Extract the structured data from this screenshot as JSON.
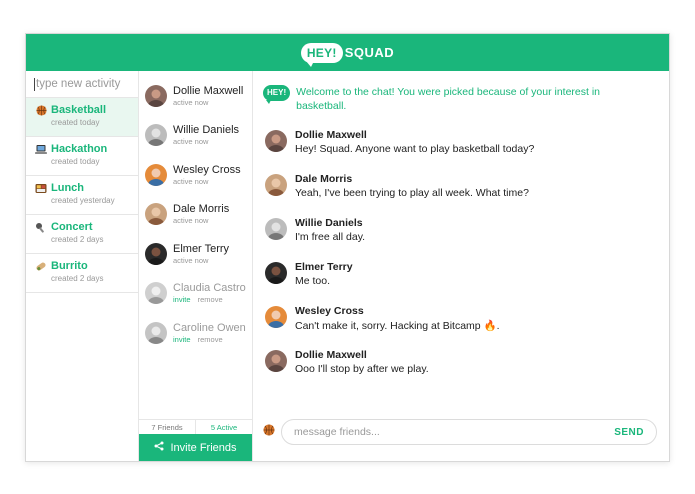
{
  "app": {
    "logo_bubble": "HEY!",
    "logo_text": "SQUAD",
    "brand_color": "#1ab67b"
  },
  "activities": {
    "placeholder": "type new activity",
    "items": [
      {
        "label": "Basketball",
        "sub": "created today",
        "icon": "basketball-icon",
        "active": true
      },
      {
        "label": "Hackathon",
        "sub": "created today",
        "icon": "laptop-icon"
      },
      {
        "label": "Lunch",
        "sub": "created yesterday",
        "icon": "lunch-icon"
      },
      {
        "label": "Concert",
        "sub": "created 2 days",
        "icon": "concert-icon"
      },
      {
        "label": "Burrito",
        "sub": "created 2 days",
        "icon": "burrito-icon"
      }
    ]
  },
  "friends": {
    "items": [
      {
        "name": "Dollie Maxwell",
        "status": "active now"
      },
      {
        "name": "Willie Daniels",
        "status": "active now"
      },
      {
        "name": "Wesley Cross",
        "status": "active now"
      },
      {
        "name": "Dale Morris",
        "status": "active now"
      },
      {
        "name": "Elmer Terry",
        "status": "active now"
      },
      {
        "name": "Claudia Castro",
        "invite": "invite",
        "remove": "remove"
      },
      {
        "name": "Caroline Owen",
        "invite": "invite",
        "remove": "remove"
      }
    ],
    "friends_count": "7 Friends",
    "active_count": "5 Active",
    "invite_button": "Invite Friends"
  },
  "chat": {
    "welcome_badge": "HEY!",
    "welcome": "Welcome to the chat! You were picked because of your interest in basketball.",
    "messages": [
      {
        "name": "Dollie Maxwell",
        "text": "Hey! Squad. Anyone want to play basketball today?"
      },
      {
        "name": "Dale Morris",
        "text": "Yeah, I've been trying to play all week. What time?"
      },
      {
        "name": "Willie Daniels",
        "text": "I'm free all day."
      },
      {
        "name": "Elmer Terry",
        "text": "Me too."
      },
      {
        "name": "Wesley Cross",
        "text": "Can't make it, sorry. Hacking at Bitcamp 🔥."
      },
      {
        "name": "Dollie Maxwell",
        "text": "Ooo I'll stop by after we play."
      }
    ],
    "input_placeholder": "message friends...",
    "send_label": "SEND"
  }
}
